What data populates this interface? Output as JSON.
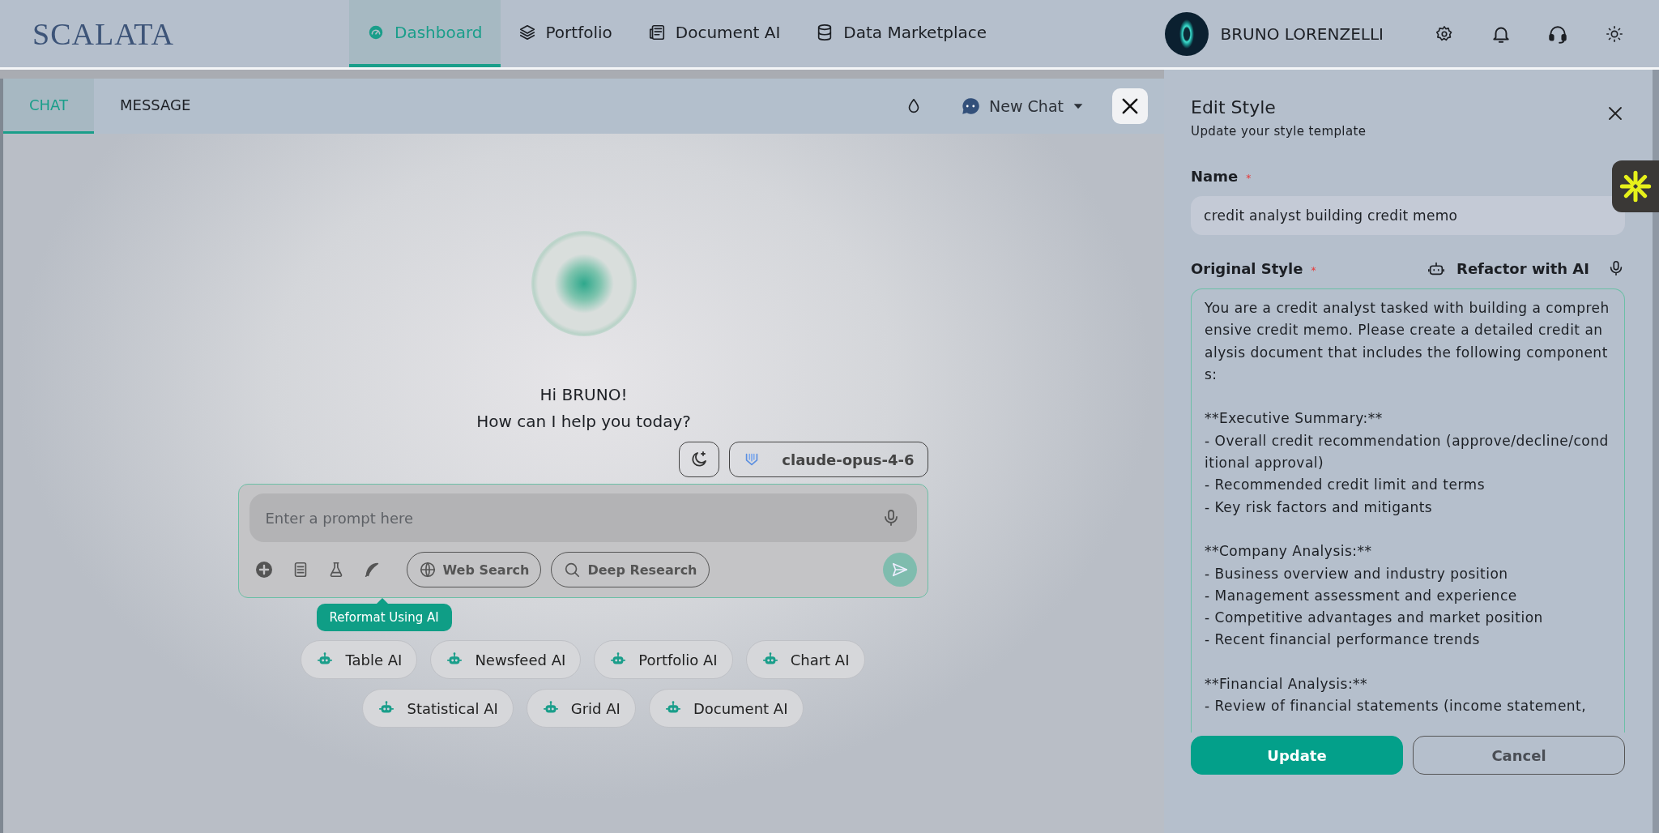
{
  "brand": {
    "logo": "SCALATA"
  },
  "nav": [
    {
      "label": "Dashboard",
      "selected": true
    },
    {
      "label": "Portfolio",
      "selected": false
    },
    {
      "label": "Document AI",
      "selected": false
    },
    {
      "label": "Data Marketplace",
      "selected": false
    }
  ],
  "user": {
    "name": "BRUNO LORENZELLI"
  },
  "chat_tabs": [
    {
      "label": "CHAT",
      "selected": true
    },
    {
      "label": "MESSAGE",
      "selected": false
    }
  ],
  "chat_header": {
    "new_chat": "New Chat"
  },
  "greeting": [
    "Hi BRUNO!",
    "How can I help you today?"
  ],
  "model": {
    "label": "claude-opus-4-6"
  },
  "prompt": {
    "placeholder": "Enter a prompt here"
  },
  "tools": [
    {
      "label": "Web Search"
    },
    {
      "label": "Deep Research"
    }
  ],
  "tooltip": "Reformat Using AI",
  "agents": [
    [
      "Table AI",
      "Newsfeed AI",
      "Portfolio AI",
      "Chart AI"
    ],
    [
      "Statistical AI",
      "Grid AI",
      "Document AI"
    ]
  ],
  "edit_style": {
    "title": "Edit Style",
    "subtitle": "Update your style template",
    "name_field": {
      "label": "Name",
      "required_mark": "*",
      "value": "credit analyst building credit memo"
    },
    "style_field": {
      "label": "Original Style",
      "required_mark": "*",
      "refactor": "Refactor with AI",
      "value": "You are a credit analyst tasked with building a comprehensive credit memo. Please create a detailed credit analysis document that includes the following components:\n\n**Executive Summary:**\n- Overall credit recommendation (approve/decline/conditional approval)\n- Recommended credit limit and terms\n- Key risk factors and mitigants\n\n**Company Analysis:**\n- Business overview and industry position\n- Management assessment and experience\n- Competitive advantages and market position\n- Recent financial performance trends\n\n**Financial Analysis:**\n- Review of financial statements (income statement,"
    },
    "buttons": [
      {
        "label": "Update",
        "kind": "primary"
      },
      {
        "label": "Cancel",
        "kind": "secondary"
      }
    ]
  }
}
